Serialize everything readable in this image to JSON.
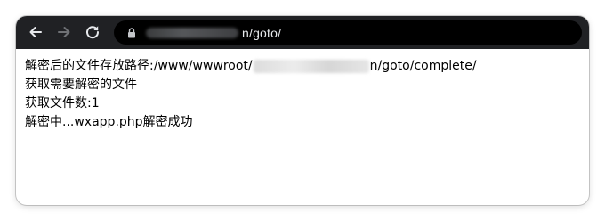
{
  "browser": {
    "url_visible_suffix": "n/goto/",
    "icons": {
      "back": "arrow-left-icon",
      "forward": "arrow-right-icon",
      "reload": "reload-icon",
      "lock": "lock-icon"
    },
    "colors": {
      "toolbar": "#202124",
      "omnibox": "#000000",
      "icon_active": "#e8eaed",
      "icon_disabled": "#6f7175"
    }
  },
  "output": {
    "line1_prefix": "解密后的文件存放路径:/www/wwwroot/",
    "line1_suffix": "n/goto/complete/",
    "line2": "获取需要解密的文件",
    "line3": "获取文件数:1",
    "line4": "解密中...wxapp.php解密成功"
  }
}
